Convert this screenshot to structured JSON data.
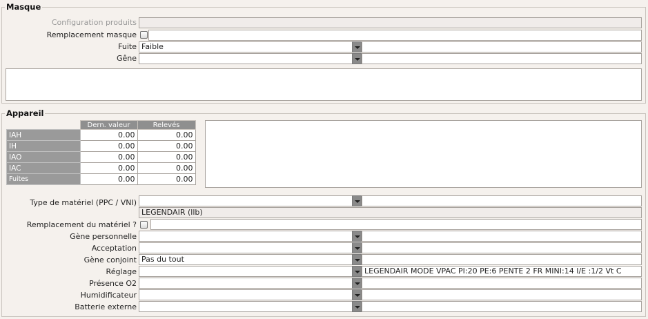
{
  "masque": {
    "legend": "Masque",
    "fields": {
      "config_label": "Configuration produits",
      "remplacement_label": "Remplacement masque",
      "fuite_label": "Fuite",
      "fuite_value": "Faible",
      "gene_label": "Gêne",
      "gene_value": ""
    }
  },
  "appareil": {
    "legend": "Appareil",
    "table": {
      "headers": [
        "Dern. valeur",
        "Relevés"
      ],
      "rows": [
        {
          "name": "IAH",
          "last": "0.00",
          "rel": "0.00"
        },
        {
          "name": "IH",
          "last": "0.00",
          "rel": "0.00"
        },
        {
          "name": "IAO",
          "last": "0.00",
          "rel": "0.00"
        },
        {
          "name": "IAC",
          "last": "0.00",
          "rel": "0.00"
        },
        {
          "name": "Fuites",
          "last": "0.00",
          "rel": "0.00"
        }
      ]
    },
    "type_label": "Type de matériel (PPC / VNI)",
    "type_value": "",
    "type_info": "LEGENDAIR (llb)",
    "remplacement_label": "Remplacement du matériel ?",
    "gene_perso_label": "Gène personnelle",
    "gene_perso_value": "",
    "acceptation_label": "Acceptation",
    "acceptation_value": "",
    "gene_conjoint_label": "Gène conjoint",
    "gene_conjoint_value": "Pas du tout",
    "reglage_label": "Réglage",
    "reglage_value": "",
    "reglage_info": "LEGENDAIR MODE VPAC PI:20 PE:6 PENTE 2 FR MINI:14 I/E :1/2 Vt C",
    "presence_label": "Présence O2",
    "presence_value": "",
    "humid_label": "Humidificateur",
    "humid_value": "",
    "batterie_label": "Batterie externe",
    "batterie_value": ""
  }
}
